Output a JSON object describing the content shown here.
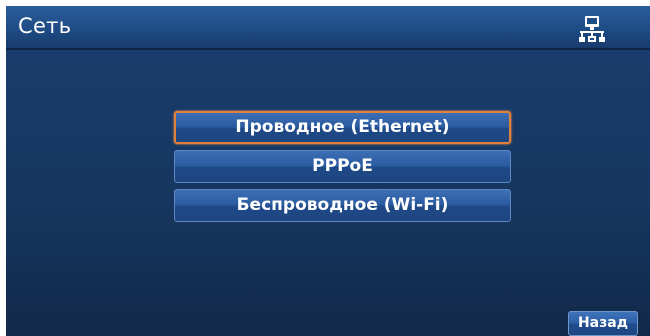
{
  "header": {
    "title": "Сеть",
    "icon": "network-icon"
  },
  "menu": {
    "items": [
      {
        "label": "Проводное (Ethernet)",
        "selected": true
      },
      {
        "label": "PPPoE",
        "selected": false
      },
      {
        "label": "Беспроводное (Wi-Fi)",
        "selected": false
      }
    ]
  },
  "footer": {
    "back_label": "Назад"
  },
  "colors": {
    "background": "#16365f",
    "header": "#1f4c85",
    "button": "#2a5a9f",
    "selection_border": "#e0803a"
  }
}
